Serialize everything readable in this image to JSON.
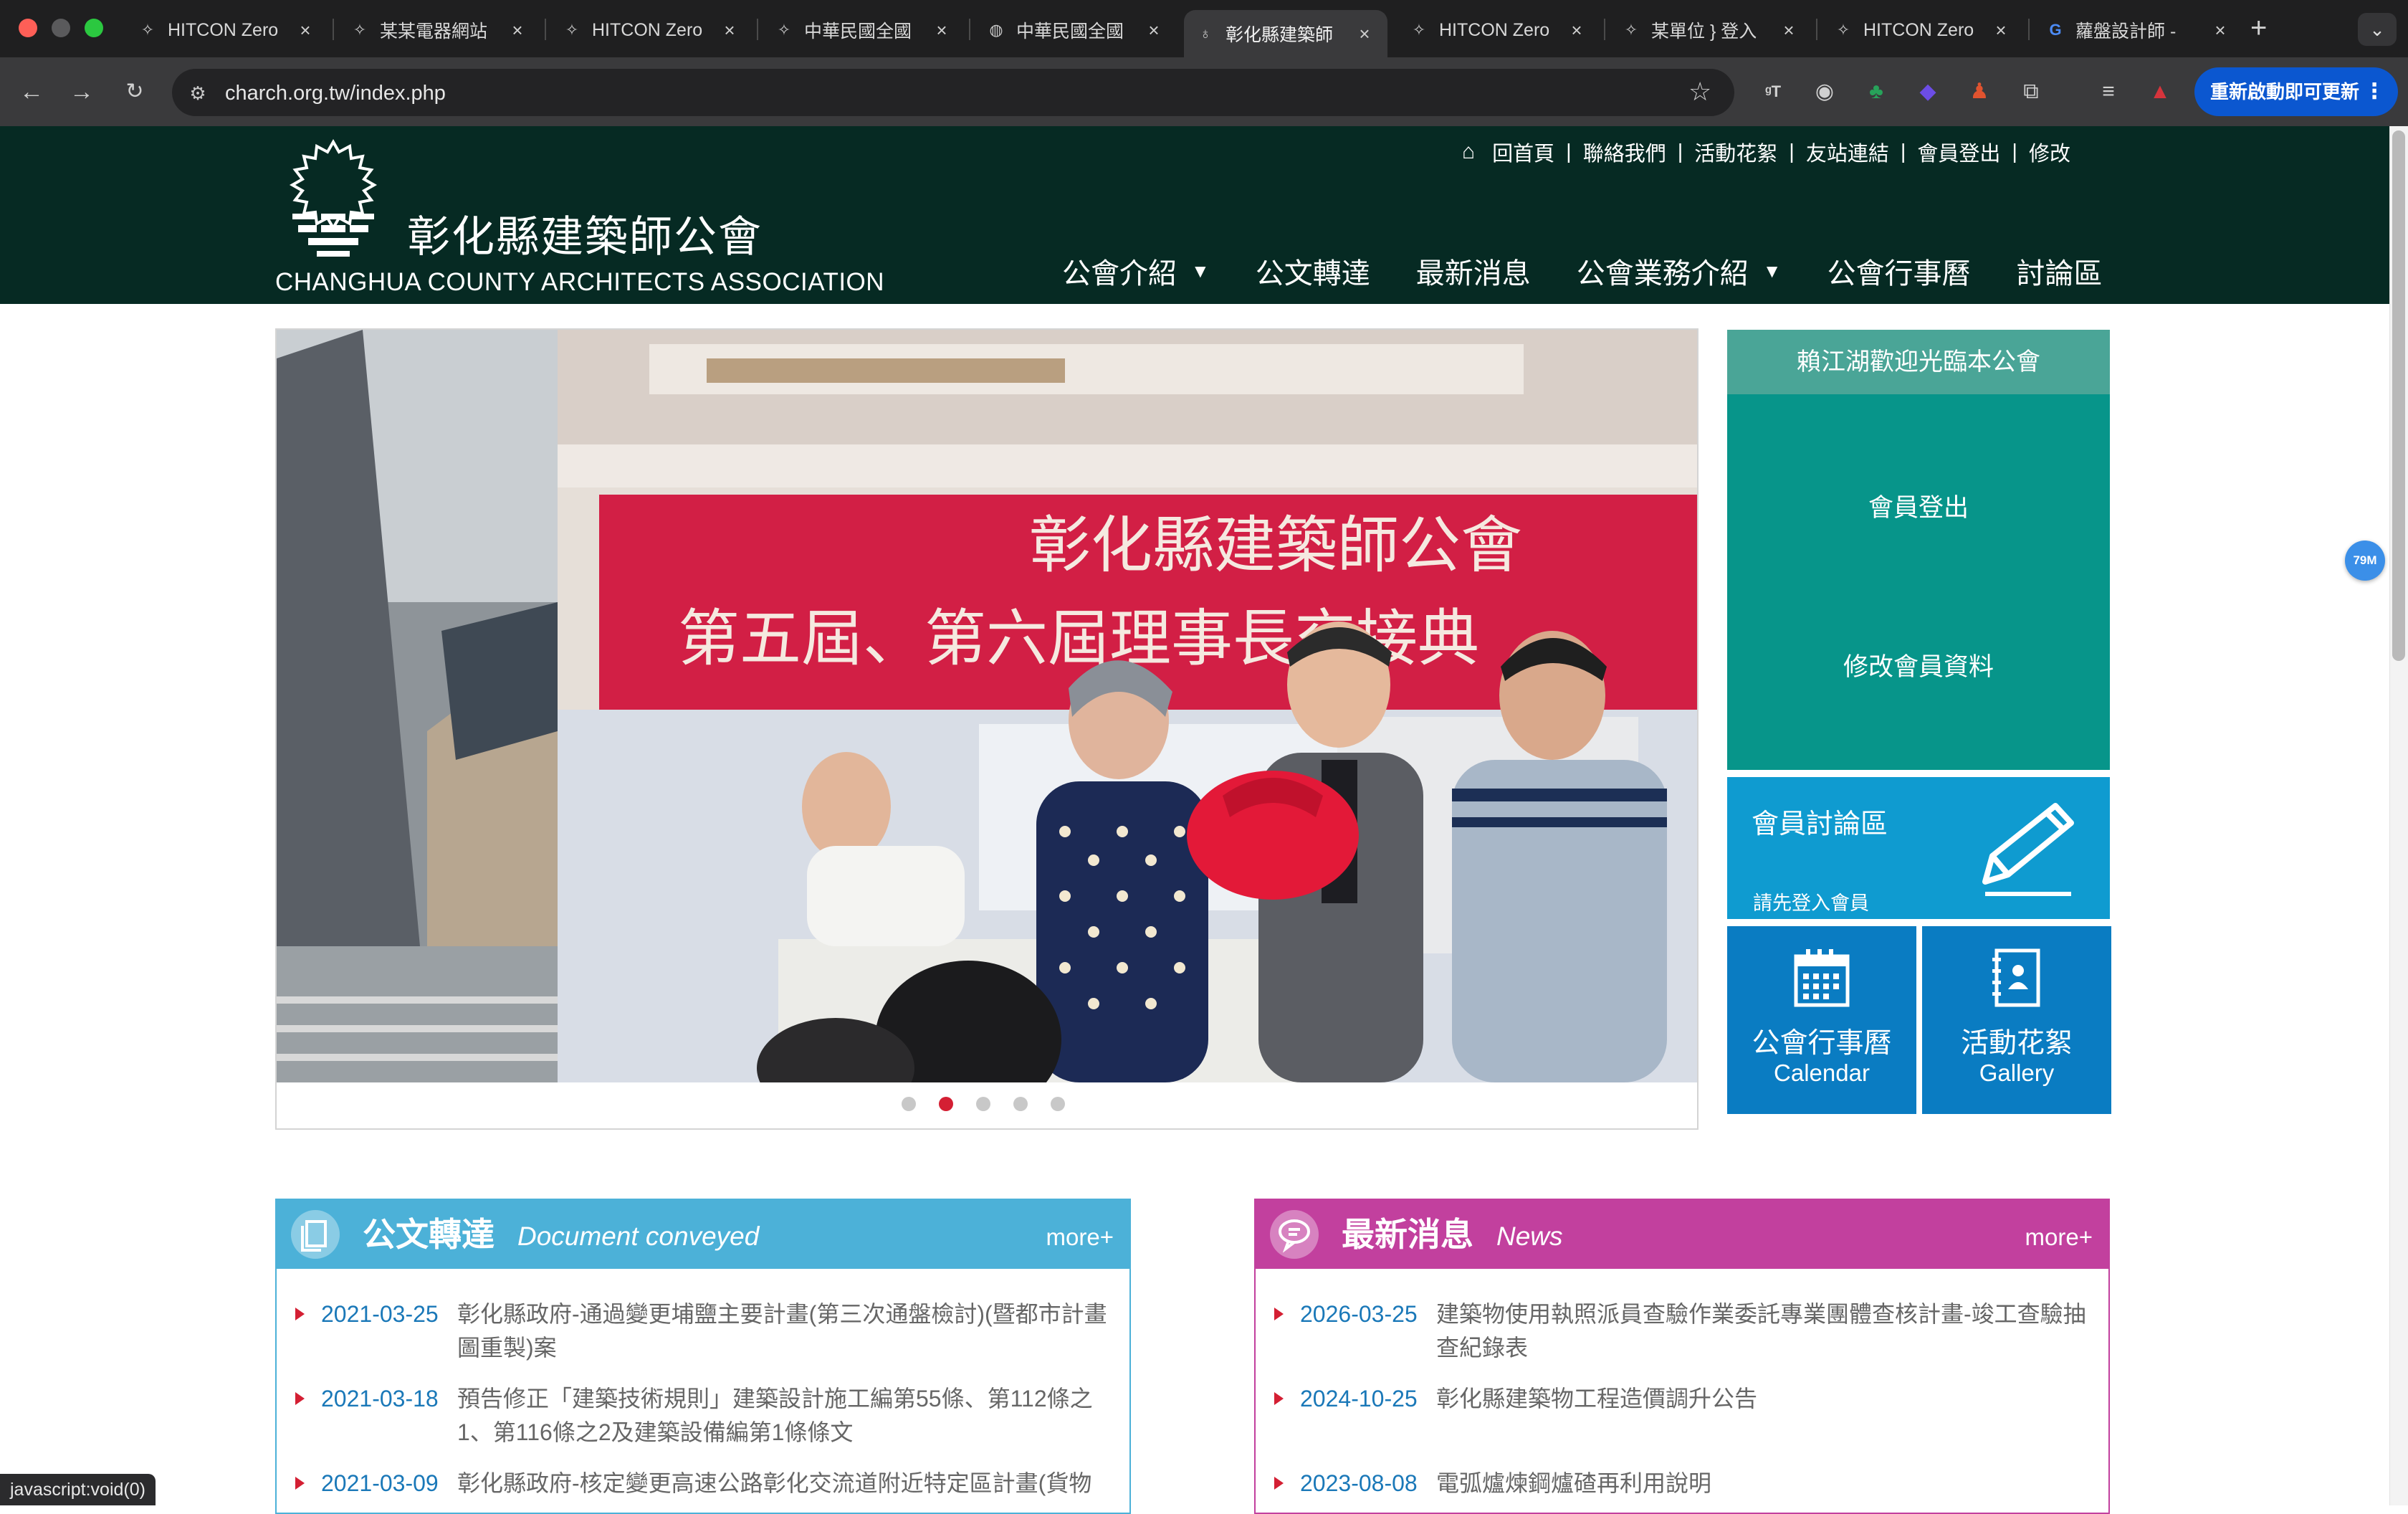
{
  "browser": {
    "tabs": [
      {
        "label": "HITCON Zero",
        "icon": "hitcon-icon"
      },
      {
        "label": "某某電器網站",
        "icon": "hitcon-icon"
      },
      {
        "label": "HITCON Zero",
        "icon": "hitcon-icon"
      },
      {
        "label": "中華民國全國",
        "icon": "hitcon-icon"
      },
      {
        "label": "中華民國全國",
        "icon": "globe-icon"
      },
      {
        "label": "彰化縣建築師",
        "icon": "bulb-icon",
        "active": true
      },
      {
        "label": "HITCON Zero",
        "icon": "hitcon-icon"
      },
      {
        "label": "某單位 } 登入",
        "icon": "hitcon-icon"
      },
      {
        "label": "HITCON Zero",
        "icon": "hitcon-icon"
      },
      {
        "label": "蘿盤設計師 -",
        "icon": "google-icon"
      }
    ],
    "url": "charch.org.tw/index.php",
    "update_button": "重新啟動即可更新",
    "status_text": "javascript:void(0)",
    "side_badge": "79M"
  },
  "header": {
    "title": "彰化縣建築師公會",
    "subtitle": "CHANGHUA COUNTY ARCHITECTS ASSOCIATION",
    "top_links": [
      "回首頁",
      "聯絡我們",
      "活動花絮",
      "友站連結",
      "會員登出",
      "修改"
    ],
    "nav": [
      {
        "label": "公會介紹",
        "dropdown": true
      },
      {
        "label": "公文轉達",
        "dropdown": false
      },
      {
        "label": "最新消息",
        "dropdown": false
      },
      {
        "label": "公會業務介紹",
        "dropdown": true
      },
      {
        "label": "公會行事曆",
        "dropdown": false
      },
      {
        "label": "討論區",
        "dropdown": false
      }
    ]
  },
  "carousel": {
    "banner_line1": "彰化縣建築師公會",
    "banner_line2": "第五屆、第六屆理事長交接典",
    "slide_count": 5,
    "active_slide": 2
  },
  "sidebar": {
    "welcome": "賴江湖歡迎光臨本公會",
    "member_logout": "會員登出",
    "edit_profile": "修改會員資料",
    "forum_title": "會員討論區",
    "forum_note": "請先登入會員",
    "calendar_zh": "公會行事曆",
    "calendar_en": "Calendar",
    "gallery_zh": "活動花絮",
    "gallery_en": "Gallery"
  },
  "documents": {
    "title": "公文轉達",
    "title_en": "Document conveyed",
    "more": "more+",
    "color": "#4cb1d8",
    "items": [
      {
        "date": "2021-03-25",
        "text": "彰化縣政府-通過變更埔鹽主要計畫(第三次通盤檢討)(暨都市計畫圖重製)案"
      },
      {
        "date": "2021-03-18",
        "text": "預告修正「建築技術規則」建築設計施工編第55條、第112條之1、第116條之2及建築設備編第1條條文"
      },
      {
        "date": "2021-03-09",
        "text": "彰化縣政府-核定變更高速公路彰化交流道附近特定區計畫(貨物"
      }
    ]
  },
  "news": {
    "title": "最新消息",
    "title_en": "News",
    "more": "more+",
    "color": "#c2409e",
    "items": [
      {
        "date": "2026-03-25",
        "text": "建築物使用執照派員查驗作業委託專業團體查核計畫-竣工查驗抽查紀錄表"
      },
      {
        "date": "2024-10-25",
        "text": "彰化縣建築物工程造價調升公告"
      },
      {
        "date": "2023-08-08",
        "text": "電弧爐煉鋼爐碴再利用說明"
      }
    ]
  }
}
